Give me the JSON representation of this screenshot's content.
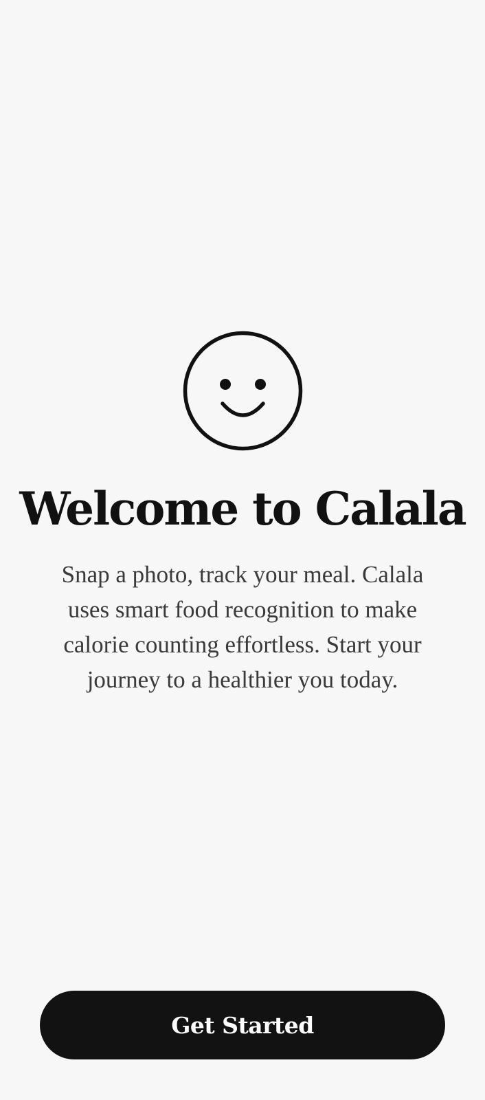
{
  "welcome": {
    "icon": "smiley-face-icon",
    "title": "Welcome to Calala",
    "description": "Snap a photo, track your meal. Calala uses smart food recognition to make calorie counting effortless. Start your journey to a healthier you today."
  },
  "actions": {
    "get_started_label": "Get Started"
  },
  "colors": {
    "background": "#f7f7f7",
    "primary": "#121212",
    "body_text": "#3a3a3a",
    "button_text": "#ffffff"
  }
}
